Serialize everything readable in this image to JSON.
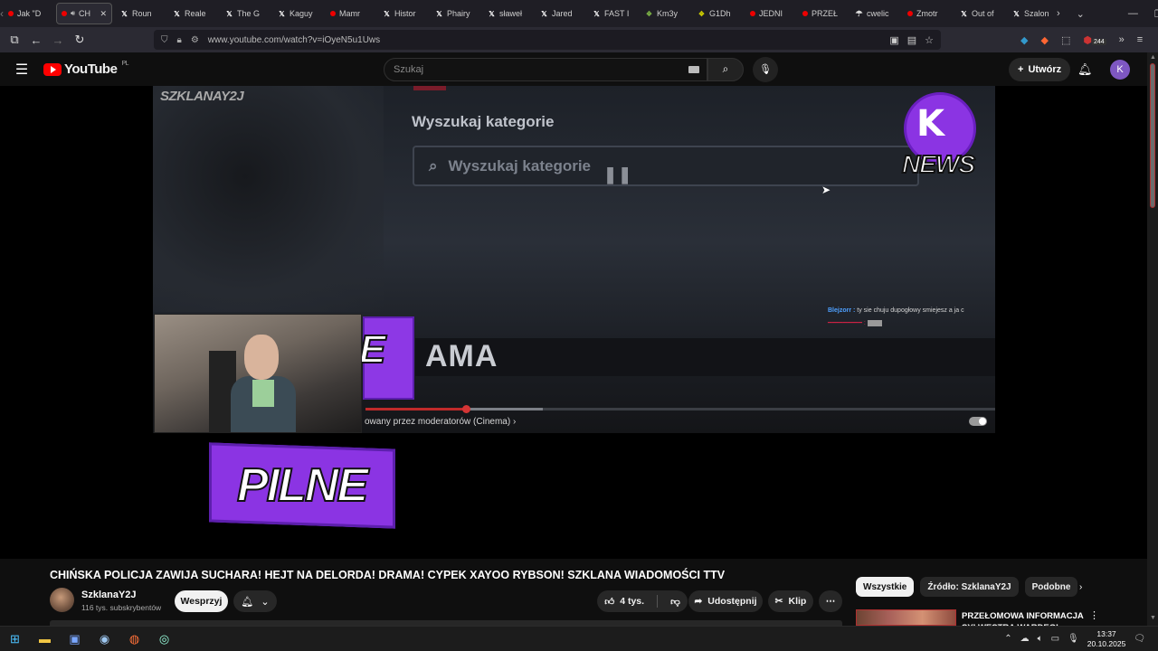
{
  "browser": {
    "tabs": [
      {
        "label": "Jak \"D",
        "favicon": "youtube"
      },
      {
        "label": "CH",
        "favicon": "youtube",
        "active": true
      },
      {
        "label": "Roun",
        "favicon": "x"
      },
      {
        "label": "Reale",
        "favicon": "x"
      },
      {
        "label": "The G",
        "favicon": "x"
      },
      {
        "label": "Kaguy",
        "favicon": "x"
      },
      {
        "label": "Mamr",
        "favicon": "youtube"
      },
      {
        "label": "Histor",
        "favicon": "x"
      },
      {
        "label": "Phairy",
        "favicon": "x"
      },
      {
        "label": "sławeł",
        "favicon": "x"
      },
      {
        "label": "Jared",
        "favicon": "x"
      },
      {
        "label": "FAST I",
        "favicon": "x"
      },
      {
        "label": "Km3y",
        "favicon": "km"
      },
      {
        "label": "G1Dh",
        "favicon": "gh"
      },
      {
        "label": "JEDNI",
        "favicon": "youtube"
      },
      {
        "label": "PRZEŁ",
        "favicon": "youtube"
      },
      {
        "label": "cwelic",
        "favicon": "tw"
      },
      {
        "label": "Zmotr",
        "favicon": "youtube"
      },
      {
        "label": "Out of",
        "favicon": "x"
      },
      {
        "label": "Szalon",
        "favicon": "x"
      }
    ],
    "url": "www.youtube.com/watch?v=iOyeN5u1Uws",
    "ext_badge": "244"
  },
  "masthead": {
    "logo_text": "YouTube",
    "region": "PL",
    "search_placeholder": "Szukaj",
    "create_label": "Utwórz",
    "avatar_letter": "K"
  },
  "player": {
    "watermark": "SZKLANAY2J",
    "category_title": "Wyszukaj kategorie",
    "category_placeholder": "Wyszukaj kategorie",
    "news_text": "NEWS",
    "chat_user": "Blejzorr :",
    "chat_message": "ty sie chuju dupogłowy smiejesz a ja c",
    "drama_text": "AMA",
    "purple_letter": "E",
    "subtitle_line": "owany przez moderatorów (Cinema) ›",
    "pilne_text": "PILNE",
    "progress_played": 0.161,
    "progress_buffered": 0.282
  },
  "video": {
    "title": "CHIŃSKA POLICJA ZAWIJA SUCHARA! HEJT NA DELORDA! DRAMA! CYPEK XAYOO RYBSON! SZKLANA WIADOMOŚCI TTV",
    "channel_name": "SzklanaY2J",
    "subscribers": "116 tys. subskrybentów",
    "support_label": "Wesprzyj",
    "likes": "4 tys.",
    "share_label": "Udostępnij",
    "clip_label": "Klip"
  },
  "sidebar": {
    "chips": [
      "Wszystkie",
      "Źródło: SzklanaY2J",
      "Podobne"
    ],
    "recommendation_title": "PRZEŁOMOWA INFORMACJA SYLWESTRA WARDEGI"
  },
  "taskbar": {
    "time": "13:37",
    "date": "20.10.2025"
  },
  "colors": {
    "accent_purple": "#8b34e3",
    "youtube_red": "#ff0000",
    "background": "#0f0f0f"
  }
}
